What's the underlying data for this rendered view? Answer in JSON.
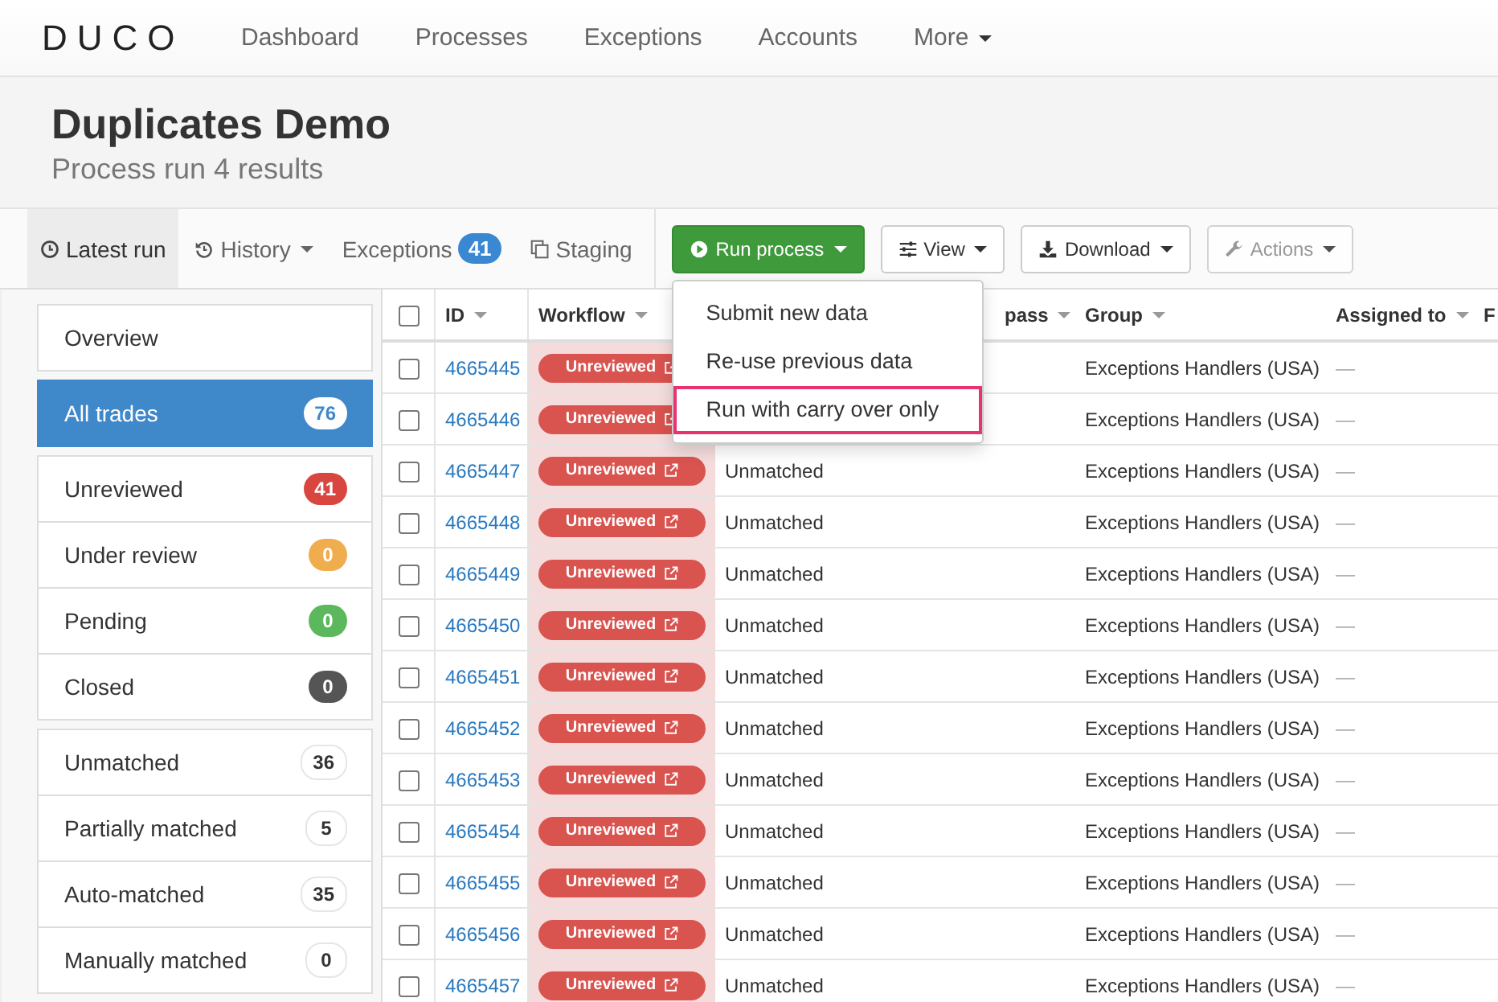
{
  "navbar": {
    "logo": "DUCO",
    "items": [
      {
        "label": "Dashboard",
        "caret": false
      },
      {
        "label": "Processes",
        "caret": false
      },
      {
        "label": "Exceptions",
        "caret": false
      },
      {
        "label": "Accounts",
        "caret": false
      },
      {
        "label": "More",
        "caret": true
      }
    ]
  },
  "header": {
    "title": "Duplicates Demo",
    "subtitle": "Process run 4 results"
  },
  "tabs": [
    {
      "label": "Latest run",
      "selected": true,
      "caret": false
    },
    {
      "label": "History",
      "selected": false,
      "caret": true
    },
    {
      "label": "Exceptions",
      "selected": false,
      "caret": false,
      "badge": "41"
    },
    {
      "label": "Staging",
      "selected": false,
      "caret": false
    }
  ],
  "buttons": [
    {
      "label": "Run process",
      "kind": "primary",
      "disabled": false
    },
    {
      "label": "View",
      "kind": "default",
      "disabled": false
    },
    {
      "label": "Download",
      "kind": "default",
      "disabled": false
    },
    {
      "label": "Actions",
      "kind": "default",
      "disabled": true
    }
  ],
  "run_menu": {
    "items": [
      {
        "label": "Submit new data",
        "selected": false
      },
      {
        "label": "Re-use previous data",
        "selected": false
      },
      {
        "label": "Run with carry over only",
        "selected": true
      }
    ]
  },
  "sidebar": {
    "groups": [
      {
        "items": [
          {
            "label": "Overview",
            "selected": false
          }
        ]
      },
      {
        "items": [
          {
            "label": "All trades",
            "selected": true,
            "count": "76",
            "color": "#ffffff"
          }
        ]
      },
      {
        "items": [
          {
            "label": "Unreviewed",
            "selected": false,
            "count": "41",
            "color": "#d9463f"
          },
          {
            "label": "Under review",
            "selected": false,
            "count": "0",
            "color": "#f0ad4e"
          },
          {
            "label": "Pending",
            "selected": false,
            "count": "0",
            "color": "#5cb85c"
          },
          {
            "label": "Closed",
            "selected": false,
            "count": "0",
            "color": "#555555"
          }
        ]
      },
      {
        "items": [
          {
            "label": "Unmatched",
            "selected": false,
            "count": "36",
            "color": "#ffffff"
          },
          {
            "label": "Partially matched",
            "selected": false,
            "count": "5",
            "color": "#ffffff"
          },
          {
            "label": "Auto-matched",
            "selected": false,
            "count": "35",
            "color": "#ffffff"
          },
          {
            "label": "Manually matched",
            "selected": false,
            "count": "0",
            "color": "#ffffff"
          }
        ]
      }
    ]
  },
  "table": {
    "select_all_checked": false,
    "columns": [
      {
        "label": "ID",
        "caret": true
      },
      {
        "label": "Workflow",
        "caret": true
      },
      {
        "label": "pass",
        "caret": true
      },
      {
        "label": "Group",
        "caret": true
      },
      {
        "label": "Assigned to",
        "caret": true
      },
      {
        "label": "F",
        "caret": false
      }
    ],
    "rows": [
      {
        "id": "4665445",
        "workflow": "Unreviewed",
        "group": "Exceptions Handlers (USA)",
        "assigned": "—",
        "checked": false
      },
      {
        "id": "4665446",
        "workflow": "Unreviewed",
        "group": "Exceptions Handlers (USA)",
        "assigned": "—",
        "checked": false
      },
      {
        "id": "4665447",
        "workflow": "Unreviewed",
        "status": "Unmatched",
        "group": "Exceptions Handlers (USA)",
        "assigned": "—",
        "checked": false
      },
      {
        "id": "4665448",
        "workflow": "Unreviewed",
        "status": "Unmatched",
        "group": "Exceptions Handlers (USA)",
        "assigned": "—",
        "checked": false
      },
      {
        "id": "4665449",
        "workflow": "Unreviewed",
        "status": "Unmatched",
        "group": "Exceptions Handlers (USA)",
        "assigned": "—",
        "checked": false
      },
      {
        "id": "4665450",
        "workflow": "Unreviewed",
        "status": "Unmatched",
        "group": "Exceptions Handlers (USA)",
        "assigned": "—",
        "checked": false
      },
      {
        "id": "4665451",
        "workflow": "Unreviewed",
        "status": "Unmatched",
        "group": "Exceptions Handlers (USA)",
        "assigned": "—",
        "checked": false
      },
      {
        "id": "4665452",
        "workflow": "Unreviewed",
        "status": "Unmatched",
        "group": "Exceptions Handlers (USA)",
        "assigned": "—",
        "checked": false
      },
      {
        "id": "4665453",
        "workflow": "Unreviewed",
        "status": "Unmatched",
        "group": "Exceptions Handlers (USA)",
        "assigned": "—",
        "checked": false
      },
      {
        "id": "4665454",
        "workflow": "Unreviewed",
        "status": "Unmatched",
        "group": "Exceptions Handlers (USA)",
        "assigned": "—",
        "checked": false
      },
      {
        "id": "4665455",
        "workflow": "Unreviewed",
        "status": "Unmatched",
        "group": "Exceptions Handlers (USA)",
        "assigned": "—",
        "checked": false
      },
      {
        "id": "4665456",
        "workflow": "Unreviewed",
        "status": "Unmatched",
        "group": "Exceptions Handlers (USA)",
        "assigned": "—",
        "checked": false
      },
      {
        "id": "4665457",
        "workflow": "Unreviewed",
        "status": "Unmatched",
        "group": "Exceptions Handlers (USA)",
        "assigned": "—",
        "checked": false
      }
    ]
  }
}
